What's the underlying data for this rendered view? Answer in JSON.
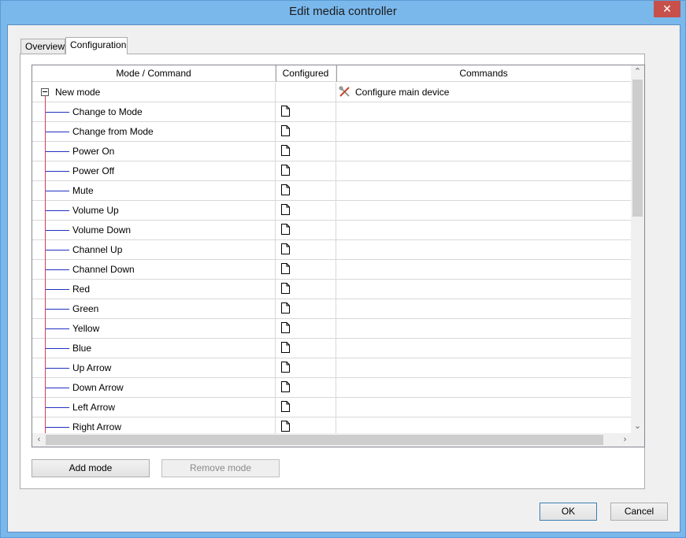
{
  "window": {
    "title": "Edit media controller",
    "close_glyph": "✕"
  },
  "tabs": [
    {
      "label": "Overview",
      "active": false
    },
    {
      "label": "Configuration",
      "active": true
    }
  ],
  "grid": {
    "columns": [
      "Mode / Command",
      "Configured",
      "Commands"
    ],
    "parent": {
      "label": "New mode",
      "command_icon": "wrench-screwdriver-icon",
      "command": "Configure main device"
    },
    "children": [
      "Change to Mode",
      "Change from Mode",
      "Power On",
      "Power Off",
      "Mute",
      "Volume Up",
      "Volume Down",
      "Channel Up",
      "Channel Down",
      "Red",
      "Green",
      "Yellow",
      "Blue",
      "Up Arrow",
      "Down Arrow",
      "Left Arrow",
      "Right Arrow"
    ],
    "configured_icon": "document-icon"
  },
  "buttons": {
    "add_mode": "Add mode",
    "remove_mode": "Remove mode",
    "ok": "OK",
    "cancel": "Cancel"
  },
  "colors": {
    "window_frame": "#7ab8ec",
    "close_button": "#c7504a",
    "tree_line_vertical": "#d04060",
    "tree_line_branch": "#2030c0"
  }
}
